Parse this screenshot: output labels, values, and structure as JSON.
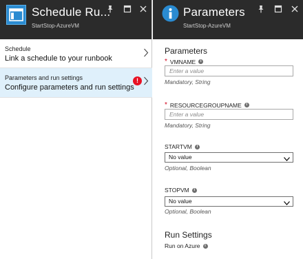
{
  "left_blade": {
    "title": "Schedule Ru...",
    "subtitle": "StartStop-AzureVM",
    "items": [
      {
        "label": "Schedule",
        "value": "Link a schedule to your runbook"
      },
      {
        "label": "Parameters and run settings",
        "value": "Configure parameters and run settings"
      }
    ],
    "error_badge": "!"
  },
  "right_blade": {
    "title": "Parameters",
    "subtitle": "StartStop-AzureVM",
    "section_title": "Parameters",
    "fields": [
      {
        "name": "VMNAME",
        "required": "*",
        "placeholder": "Enter a value",
        "hint": "Mandatory, String"
      },
      {
        "name": "RESOURCEGROUPNAME",
        "required": "*",
        "placeholder": "Enter a value",
        "hint": "Mandatory, String"
      },
      {
        "name": "STARTVM",
        "value": "No value",
        "hint": "Optional, Boolean"
      },
      {
        "name": "STOPVM",
        "value": "No value",
        "hint": "Optional, Boolean"
      }
    ],
    "run_settings_title": "Run Settings",
    "run_on_label": "Run on Azure"
  },
  "icons": [
    "runbook-icon",
    "info-circle-icon",
    "pin-icon",
    "maximize-icon",
    "close-icon",
    "chevron-right-icon",
    "error-icon",
    "info-icon",
    "chevron-down-icon"
  ],
  "colors": {
    "header_bg": "#2b2b2b",
    "selected_item_bg": "#dff0fb",
    "error_red": "#e81123",
    "required_red": "#d0021b"
  }
}
